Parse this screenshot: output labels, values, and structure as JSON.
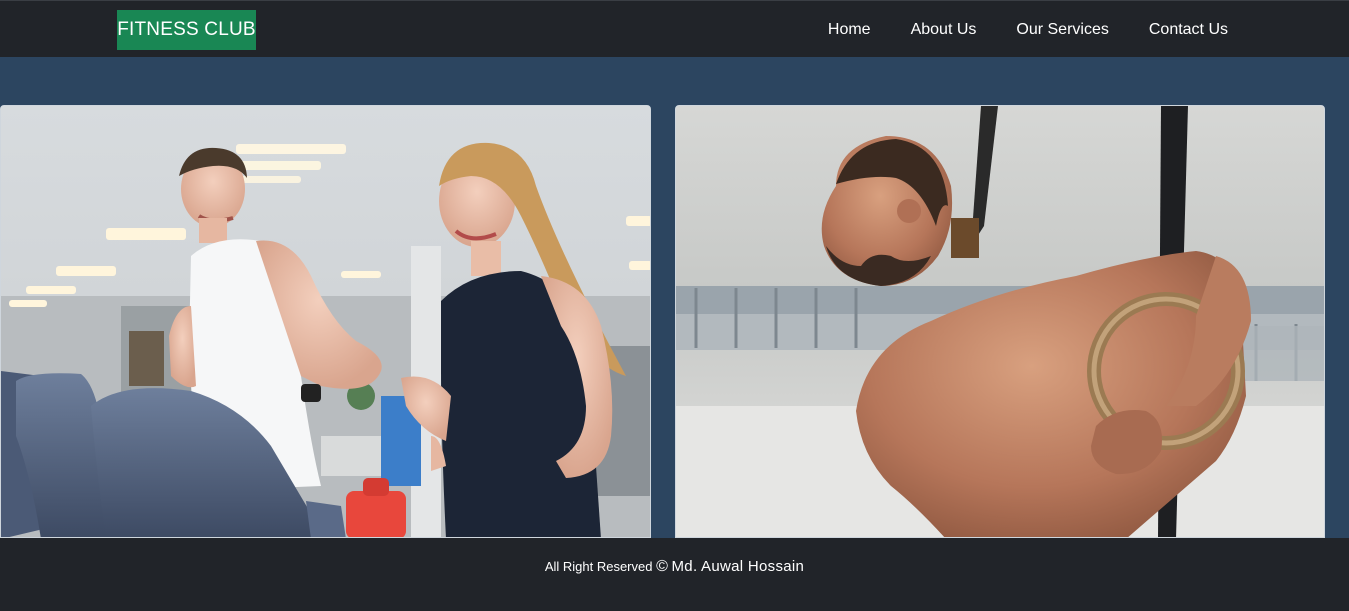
{
  "navbar": {
    "brand": "FITNESS CLUB",
    "links": [
      "Home",
      "About Us",
      "Our Services",
      "Contact Us"
    ],
    "brand_color": "#198754",
    "background": "#212429"
  },
  "main": {
    "background": "#2c4560",
    "images": [
      {
        "icon": "treadmill-couple-photo"
      },
      {
        "icon": "gymnastic-rings-athlete-photo"
      }
    ]
  },
  "footer": {
    "text": "All Right Reserved",
    "copyright_symbol": "©",
    "author": "Md. Auwal Hossain"
  }
}
